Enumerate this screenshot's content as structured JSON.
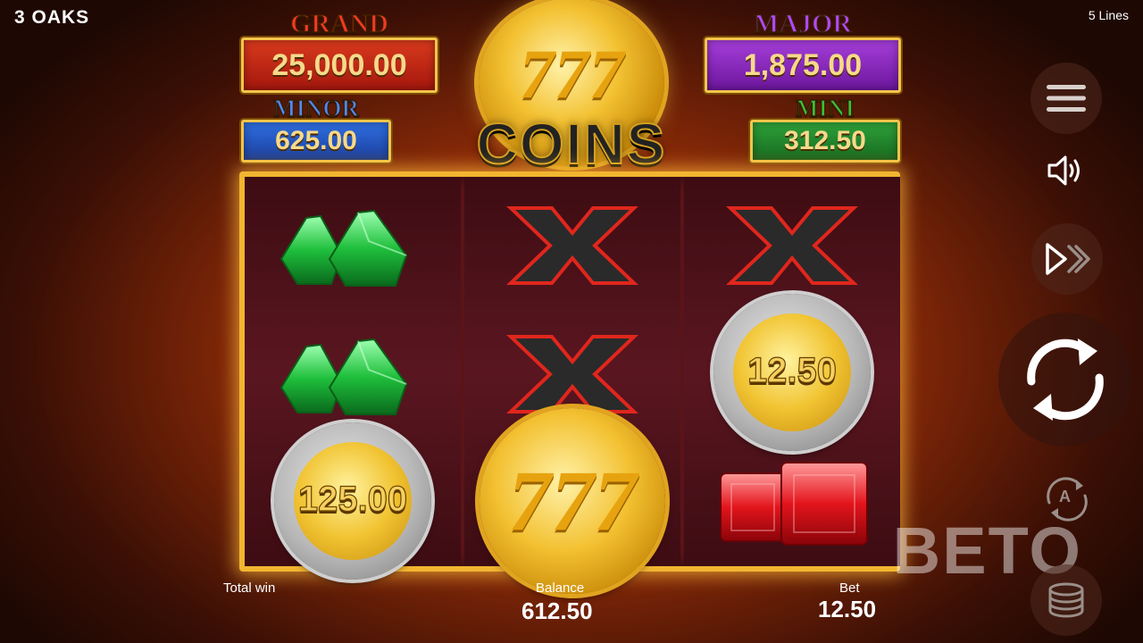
{
  "header": {
    "brand": "3 OAKS",
    "lines": "5 Lines"
  },
  "jackpots": {
    "grand": {
      "title": "GRAND",
      "value": "25,000.00"
    },
    "major": {
      "title": "MAJOR",
      "value": "1,875.00"
    },
    "minor": {
      "title": "MINOR",
      "value": "625.00"
    },
    "mini": {
      "title": "MINI",
      "value": "312.50"
    }
  },
  "logo": {
    "text": "COINS",
    "coin_mark": "777"
  },
  "reels": {
    "r1": [
      {
        "symbol": "green-gems"
      },
      {
        "symbol": "green-gems"
      },
      {
        "symbol": "silver-coin",
        "value": "125.00"
      }
    ],
    "r2": [
      {
        "symbol": "x"
      },
      {
        "symbol": "x"
      },
      {
        "symbol": "gold-777-coin",
        "mark": "777"
      }
    ],
    "r3": [
      {
        "symbol": "x"
      },
      {
        "symbol": "silver-coin",
        "value": "12.50"
      },
      {
        "symbol": "red-gems"
      }
    ]
  },
  "footer": {
    "total_win_label": "Total win",
    "balance_label": "Balance",
    "balance_value": "612.50",
    "bet_label": "Bet",
    "bet_value": "12.50"
  },
  "controls": {
    "menu": "menu-icon",
    "sound": "speaker-icon",
    "turbo": "fast-forward-icon",
    "spin": "spin-icon",
    "autoplay": "autoplay-icon",
    "autoplay_letter": "A",
    "bet_coins": "coin-stack-icon"
  },
  "watermark": {
    "text": "BETO"
  },
  "colors": {
    "frame": "#f2b530",
    "grand": "#d93a1d",
    "major": "#a53ed9",
    "minor": "#2f6fe0",
    "mini": "#2fa23a"
  }
}
